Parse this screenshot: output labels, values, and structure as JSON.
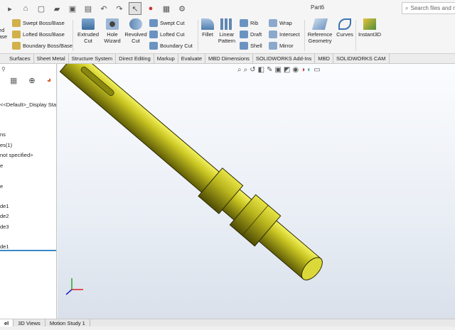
{
  "app": {
    "document_title": "Part6"
  },
  "search": {
    "placeholder": "Search files and models"
  },
  "ribbon": {
    "features": [
      {
        "id": "extruded-boss",
        "label": "Extruded\nBoss/Base",
        "label_partial": "ed\nase"
      },
      {
        "id": "swept-boss",
        "label": "Swept Boss/Base"
      },
      {
        "id": "lofted-boss",
        "label": "Lofted Boss/Base"
      },
      {
        "id": "boundary-boss",
        "label": "Boundary Boss/Base"
      },
      {
        "id": "extruded-cut",
        "label": "Extruded\nCut"
      },
      {
        "id": "hole-wizard",
        "label": "Hole\nWizard"
      },
      {
        "id": "revolved-cut",
        "label": "Revolved\nCut"
      },
      {
        "id": "swept-cut",
        "label": "Swept Cut"
      },
      {
        "id": "lofted-cut",
        "label": "Lofted Cut"
      },
      {
        "id": "boundary-cut",
        "label": "Boundary Cut"
      },
      {
        "id": "fillet",
        "label": "Fillet"
      },
      {
        "id": "linear-pattern",
        "label": "Linear\nPattern"
      },
      {
        "id": "rib",
        "label": "Rib"
      },
      {
        "id": "draft",
        "label": "Draft"
      },
      {
        "id": "shell",
        "label": "Shell"
      },
      {
        "id": "wrap",
        "label": "Wrap"
      },
      {
        "id": "intersect",
        "label": "Intersect"
      },
      {
        "id": "mirror",
        "label": "Mirror"
      },
      {
        "id": "reference-geometry",
        "label": "Reference\nGeometry"
      },
      {
        "id": "curves",
        "label": "Curves"
      },
      {
        "id": "instant3d",
        "label": "Instant3D"
      }
    ]
  },
  "tabs": [
    "Surfaces",
    "Sheet Metal",
    "Structure System",
    "Direct Editing",
    "Markup",
    "Evaluate",
    "MBD Dimensions",
    "SOLIDWORKS Add-Ins",
    "MBD",
    "SOLIDWORKS CAM"
  ],
  "tree": {
    "rows": [
      "<<Default>_Display Sta",
      "ns",
      "es(1)",
      "not specified>",
      "e",
      "e",
      "de1",
      "de2",
      "de3",
      "de1"
    ]
  },
  "bottom_tabs": [
    "el",
    "3D Views",
    "Motion Study 1"
  ],
  "colors": {
    "part": "#a8a81a",
    "accent": "#3a88c8"
  }
}
